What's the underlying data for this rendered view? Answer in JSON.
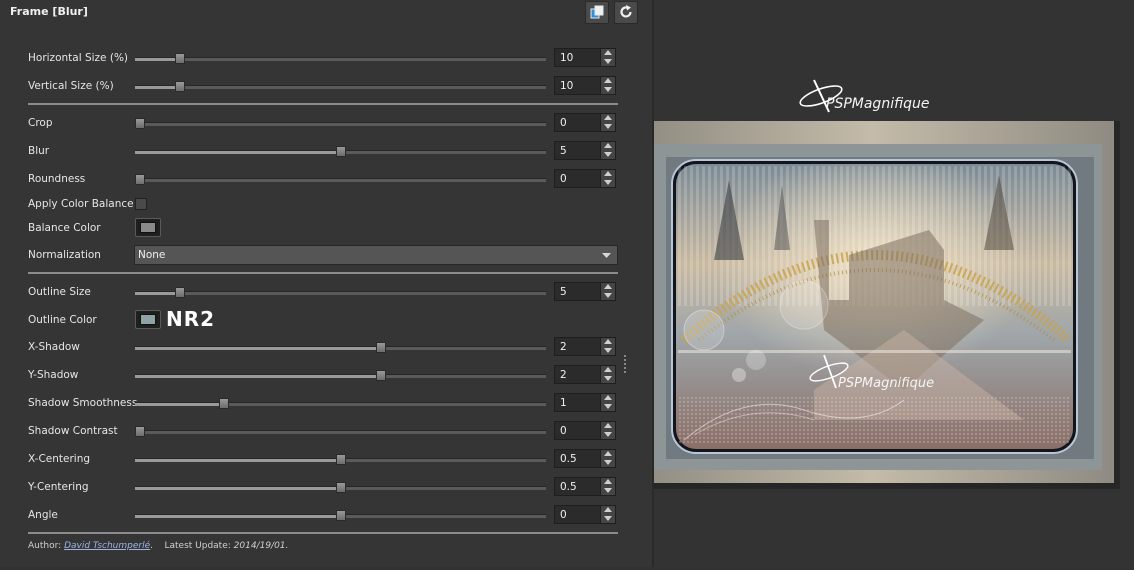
{
  "window": {
    "title": "Frame [Blur]",
    "buttons": [
      {
        "name": "layers-icon"
      },
      {
        "name": "refresh-icon"
      }
    ]
  },
  "params": [
    {
      "type": "slider",
      "label": "Horizontal Size (%)",
      "value": "10",
      "fraction": 0.1
    },
    {
      "type": "slider",
      "label": "Vertical Size (%)",
      "value": "10",
      "fraction": 0.1
    },
    {
      "type": "separator"
    },
    {
      "type": "slider",
      "label": "Crop",
      "value": "0",
      "fraction": 0.0
    },
    {
      "type": "slider",
      "label": "Blur",
      "value": "5",
      "fraction": 0.5
    },
    {
      "type": "slider",
      "label": "Roundness",
      "value": "0",
      "fraction": 0.0
    },
    {
      "type": "checkbox",
      "label": "Apply Color Balance",
      "checked": false
    },
    {
      "type": "color",
      "label": "Balance Color",
      "color": "#8a8a8a"
    },
    {
      "type": "select",
      "label": "Normalization",
      "value": "None"
    },
    {
      "type": "separator"
    },
    {
      "type": "slider",
      "label": "Outline Size",
      "value": "5",
      "fraction": 0.1
    },
    {
      "type": "color",
      "label": "Outline Color",
      "color": "#8fa3a6",
      "note": "NR2"
    },
    {
      "type": "slider",
      "label": "X-Shadow",
      "value": "2",
      "fraction": 0.6
    },
    {
      "type": "slider",
      "label": "Y-Shadow",
      "value": "2",
      "fraction": 0.6
    },
    {
      "type": "slider",
      "label": "Shadow Smoothness",
      "value": "1",
      "fraction": 0.21
    },
    {
      "type": "slider",
      "label": "Shadow Contrast",
      "value": "0",
      "fraction": 0.0
    },
    {
      "type": "slider",
      "label": "X-Centering",
      "value": "0.5",
      "fraction": 0.5
    },
    {
      "type": "slider",
      "label": "Y-Centering",
      "value": "0.5",
      "fraction": 0.5
    },
    {
      "type": "slider",
      "label": "Angle",
      "value": "0",
      "fraction": 0.5
    },
    {
      "type": "separator"
    }
  ],
  "footer": {
    "author_label": "Author:",
    "author_name": "David Tschumperlé",
    "author_suffix": ".",
    "update_label": "Latest Update:",
    "update_date": "2014/19/01."
  },
  "preview": {
    "logo_top": "PSPMagnifique",
    "watermark": "PSPMagnifique",
    "colors": {
      "frame": "#8d9596",
      "outer": "#b3ab9c",
      "accent": "#c9a24a"
    }
  }
}
